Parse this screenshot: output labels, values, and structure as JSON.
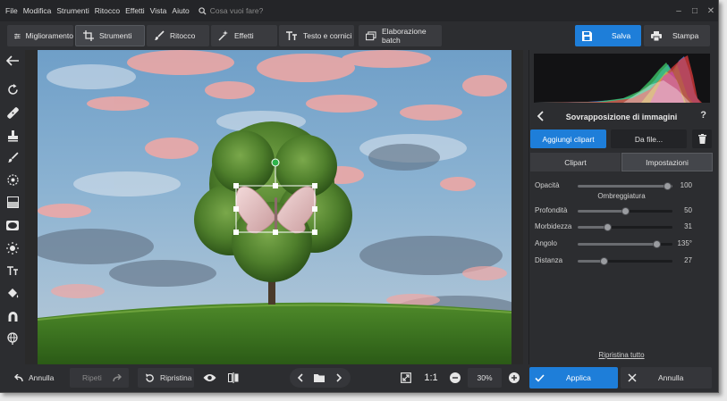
{
  "menu": {
    "items": [
      "File",
      "Modifica",
      "Strumenti",
      "Ritocco",
      "Effetti",
      "Vista",
      "Aiuto"
    ],
    "search_placeholder": "Cosa vuoi fare?"
  },
  "toolbar": {
    "tabs": [
      {
        "label": "Miglioramento",
        "icon": "sliders-icon"
      },
      {
        "label": "Strumenti",
        "icon": "crop-icon",
        "active": true
      },
      {
        "label": "Ritocco",
        "icon": "brush-icon"
      },
      {
        "label": "Effetti",
        "icon": "magic-wand-icon"
      },
      {
        "label": "Testo e cornici",
        "icon": "text-icon"
      },
      {
        "label": "Elaborazione batch",
        "icon": "batch-icon"
      }
    ],
    "save_label": "Salva",
    "print_label": "Stampa"
  },
  "left_tools": [
    "back-arrow-icon",
    "rotate-icon",
    "heal-icon",
    "stamp-icon",
    "brush-icon",
    "radial-icon",
    "gradient-icon",
    "vignette-icon",
    "light-icon",
    "text-tool-icon",
    "fill-icon",
    "magnet-icon",
    "globe-icon"
  ],
  "panel": {
    "title": "Sovrapposizione di immagini",
    "help": "?",
    "add_clipart": "Aggiungi clipart",
    "from_file": "Da file...",
    "tab_clipart": "Clipart",
    "tab_settings": "Impostazioni",
    "opacity": {
      "label": "Opacità",
      "value": 100
    },
    "shadow_section": "Ombreggiatura",
    "sliders": [
      {
        "label": "Profondità",
        "value": "50",
        "pos": 0.5
      },
      {
        "label": "Morbidezza",
        "value": "31",
        "pos": 0.31
      },
      {
        "label": "Angolo",
        "value": "135°",
        "pos": 0.83
      },
      {
        "label": "Distanza",
        "value": "27",
        "pos": 0.27
      }
    ],
    "reset_all": "Ripristina tutto"
  },
  "bottom": {
    "undo": "Annulla",
    "redo": "Ripeti",
    "restore": "Ripristina",
    "ratio": "1:1",
    "zoom": "30%",
    "apply": "Applica",
    "cancel": "Annulla"
  },
  "colors": {
    "accent": "#1e7ed9",
    "bg": "#2c2d30"
  }
}
